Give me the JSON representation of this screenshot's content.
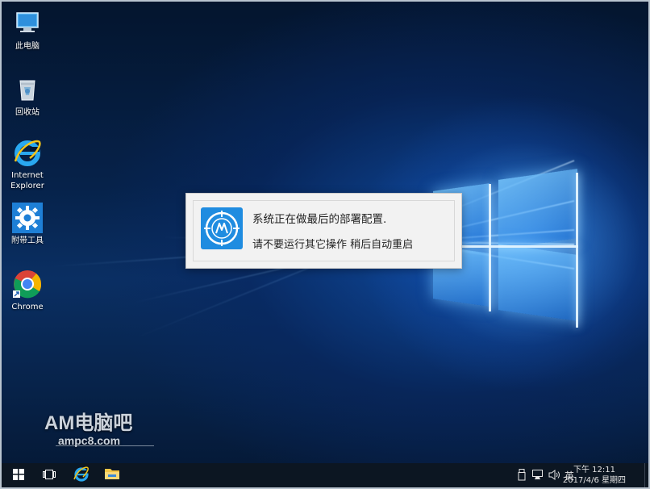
{
  "desktop": {
    "icons": [
      {
        "label": "此电脑",
        "icon": "this-pc-icon"
      },
      {
        "label": "回收站",
        "icon": "recycle-bin-icon"
      },
      {
        "label": "Internet Explorer",
        "icon": "internet-explorer-icon"
      },
      {
        "label": "附带工具",
        "icon": "tools-gear-icon"
      },
      {
        "label": "Chrome",
        "icon": "chrome-icon"
      }
    ]
  },
  "dialog": {
    "line1": "系统正在做最后的部署配置.",
    "line2": "请不要运行其它操作 稍后自动重启",
    "icon": "deploy-logo-icon",
    "accent": "#1f8ce0"
  },
  "watermark": {
    "brand": "AM电脑吧",
    "site": "ampc8.com"
  },
  "taskbar": {
    "buttons": [
      {
        "icon": "start-windows-icon"
      },
      {
        "icon": "task-view-icon"
      },
      {
        "icon": "internet-explorer-icon"
      },
      {
        "icon": "file-explorer-icon"
      }
    ],
    "tray": {
      "icons": [
        "usb-device-icon",
        "network-icon",
        "volume-icon"
      ],
      "ime": "英",
      "time": "下午 12:11",
      "date": "2017/4/6 星期四"
    }
  },
  "colors": {
    "taskbar": "#0c1622",
    "wallpaper_accent": "#2a8cf0"
  }
}
